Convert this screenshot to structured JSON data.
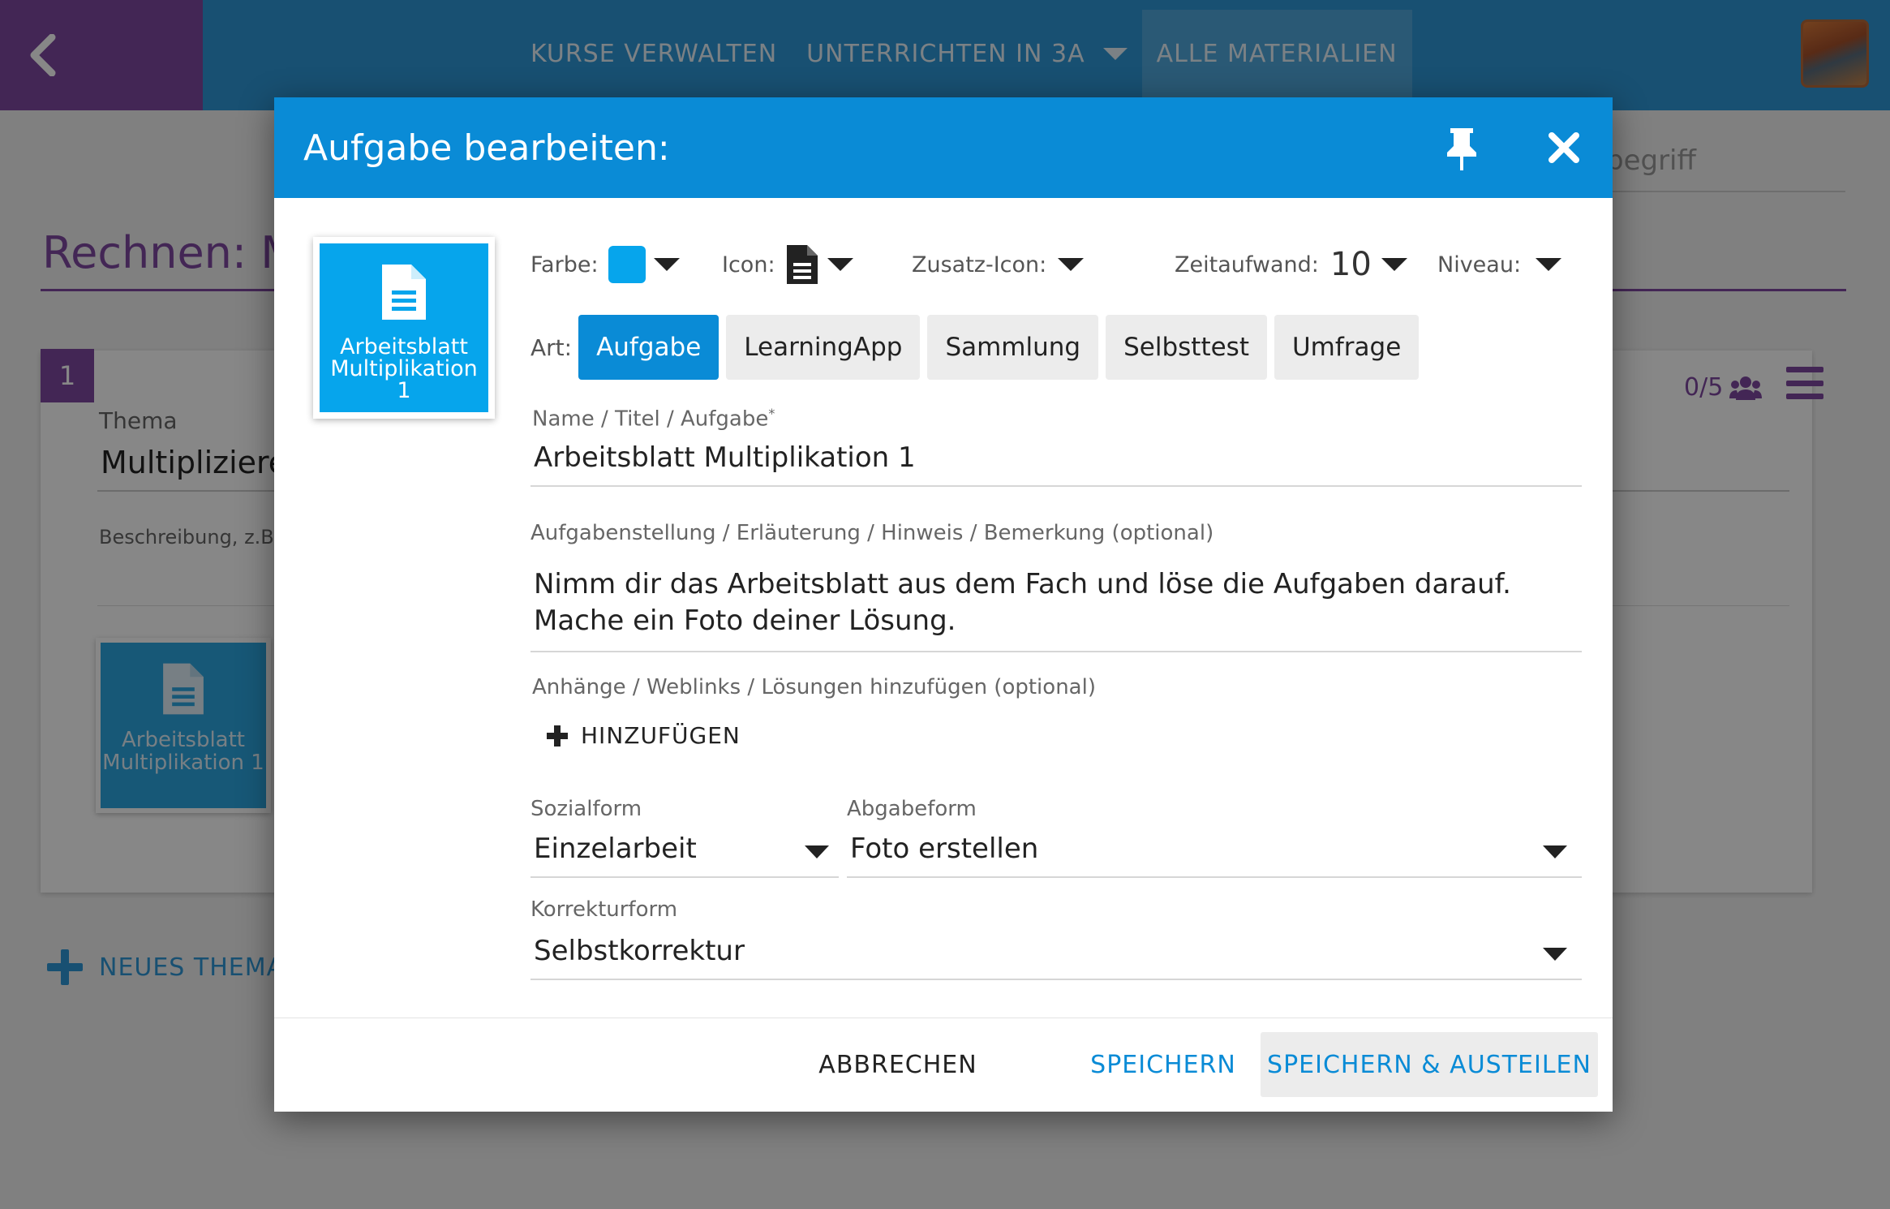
{
  "topbar": {
    "nav": [
      {
        "label": "KURSE VERWALTEN"
      },
      {
        "label": "UNTERRICHTEN IN 3A"
      },
      {
        "label": "ALLE MATERIALIEN"
      }
    ]
  },
  "background": {
    "search_fragment": "begriff",
    "page_title": "Rechnen: M",
    "topic_number": "1",
    "topic_label": "Thema",
    "topic_value": "Multipliziere",
    "description_placeholder": "Beschreibung, z.B. L",
    "progress": "0/5",
    "material_tile_label": "Arbeitsblatt Multiplikation 1",
    "new_topic_label": "NEUES THEMA"
  },
  "dialog": {
    "title": "Aufgabe bearbeiten:",
    "preview_label": "Arbeitsblatt Multiplikation 1",
    "options": {
      "farbe_label": "Farbe:",
      "farbe_color": "#06a5ec",
      "icon_label": "Icon:",
      "icon_name": "document-icon",
      "zusatz_icon_label": "Zusatz-Icon:",
      "zeitaufwand_label": "Zeitaufwand:",
      "zeitaufwand_value": "10",
      "niveau_label": "Niveau:"
    },
    "art": {
      "label": "Art:",
      "buttons": [
        "Aufgabe",
        "LearningApp",
        "Sammlung",
        "Selbsttest",
        "Umfrage"
      ],
      "selected": "Aufgabe"
    },
    "name": {
      "label": "Name / Titel / Aufgabe",
      "required_mark": "*",
      "value": "Arbeitsblatt Multiplikation 1"
    },
    "description": {
      "label": "Aufgabenstellung / Erläuterung / Hinweis / Bemerkung (optional)",
      "line1": "Nimm dir das Arbeitsblatt aus dem Fach und löse die Aufgaben darauf.",
      "line2": "Mache ein Foto deiner Lösung."
    },
    "attachments": {
      "label": "Anhänge / Weblinks / Lösungen hinzufügen (optional)",
      "add_label": "HINZUFÜGEN"
    },
    "sozialform": {
      "label": "Sozialform",
      "value": "Einzelarbeit"
    },
    "abgabeform": {
      "label": "Abgabeform",
      "value": "Foto erstellen"
    },
    "korrekturform": {
      "label": "Korrekturform",
      "value": "Selbstkorrektur"
    },
    "footer": {
      "cancel": "ABBRECHEN",
      "save": "SPEICHERN",
      "save_share": "SPEICHERN & AUSTEILEN"
    }
  },
  "colors": {
    "header_blue": "#0a8bd6",
    "topbar_blue": "#2f98d8",
    "purple": "#7f49a0",
    "tile_blue": "#06a5ec"
  }
}
